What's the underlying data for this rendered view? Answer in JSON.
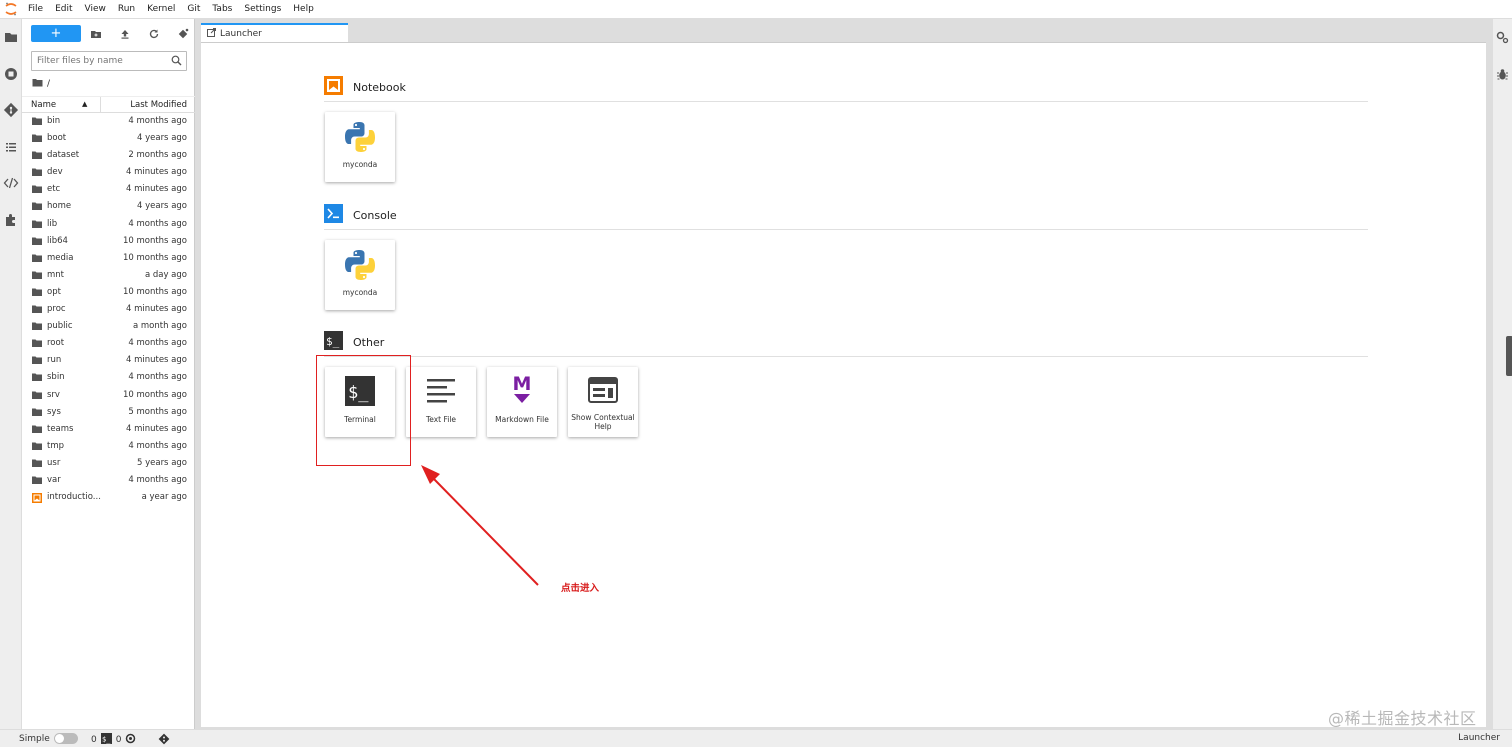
{
  "menubar": {
    "items": [
      "File",
      "Edit",
      "View",
      "Run",
      "Kernel",
      "Git",
      "Tabs",
      "Settings",
      "Help"
    ]
  },
  "filebrowser": {
    "new_label": "+",
    "filter_placeholder": "Filter files by name",
    "breadcrumb": "/",
    "col_name": "Name",
    "col_modified": "Last Modified",
    "files": [
      {
        "name": "bin",
        "modified": "4 months ago",
        "type": "folder"
      },
      {
        "name": "boot",
        "modified": "4 years ago",
        "type": "folder"
      },
      {
        "name": "dataset",
        "modified": "2 months ago",
        "type": "folder"
      },
      {
        "name": "dev",
        "modified": "4 minutes ago",
        "type": "folder"
      },
      {
        "name": "etc",
        "modified": "4 minutes ago",
        "type": "folder"
      },
      {
        "name": "home",
        "modified": "4 years ago",
        "type": "folder"
      },
      {
        "name": "lib",
        "modified": "4 months ago",
        "type": "folder"
      },
      {
        "name": "lib64",
        "modified": "10 months ago",
        "type": "folder"
      },
      {
        "name": "media",
        "modified": "10 months ago",
        "type": "folder"
      },
      {
        "name": "mnt",
        "modified": "a day ago",
        "type": "folder"
      },
      {
        "name": "opt",
        "modified": "10 months ago",
        "type": "folder"
      },
      {
        "name": "proc",
        "modified": "4 minutes ago",
        "type": "folder"
      },
      {
        "name": "public",
        "modified": "a month ago",
        "type": "folder"
      },
      {
        "name": "root",
        "modified": "4 months ago",
        "type": "folder"
      },
      {
        "name": "run",
        "modified": "4 minutes ago",
        "type": "folder"
      },
      {
        "name": "sbin",
        "modified": "4 months ago",
        "type": "folder"
      },
      {
        "name": "srv",
        "modified": "10 months ago",
        "type": "folder"
      },
      {
        "name": "sys",
        "modified": "5 months ago",
        "type": "folder"
      },
      {
        "name": "teams",
        "modified": "4 minutes ago",
        "type": "folder"
      },
      {
        "name": "tmp",
        "modified": "4 months ago",
        "type": "folder"
      },
      {
        "name": "usr",
        "modified": "5 years ago",
        "type": "folder"
      },
      {
        "name": "var",
        "modified": "4 months ago",
        "type": "folder"
      },
      {
        "name": "introductio...",
        "modified": "a year ago",
        "type": "notebook"
      }
    ]
  },
  "tabs": [
    {
      "label": "Launcher"
    }
  ],
  "launcher": {
    "notebook": {
      "title": "Notebook",
      "cards": [
        {
          "label": "myconda"
        }
      ]
    },
    "console": {
      "title": "Console",
      "cards": [
        {
          "label": "myconda"
        }
      ]
    },
    "other": {
      "title": "Other",
      "cards": [
        {
          "label": "Terminal"
        },
        {
          "label": "Text File"
        },
        {
          "label": "Markdown File"
        },
        {
          "label": "Show Contextual Help"
        }
      ]
    }
  },
  "annotation": {
    "text": "点击进入",
    "color": "#d81b1b"
  },
  "statusbar": {
    "mode_label": "Simple",
    "kernels_count": "0",
    "terminals_count": "0",
    "right_label": "Launcher"
  },
  "watermark": "@稀土掘金技术社区",
  "colors": {
    "accent": "#2196f3",
    "notebook": "#f57c00",
    "console": "#1e88e5",
    "markdown": "#7b1fa2"
  }
}
